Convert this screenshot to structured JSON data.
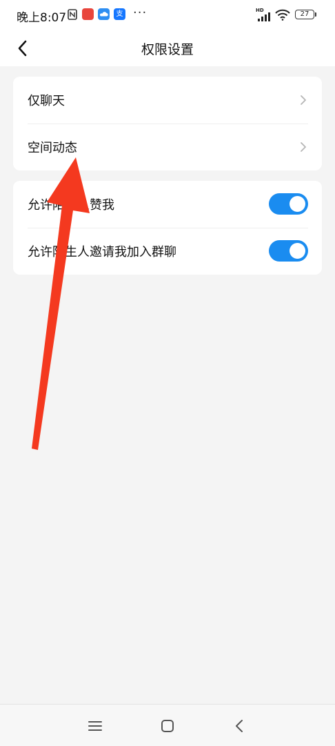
{
  "status_bar": {
    "time": "晚上8:07",
    "hd_label": "HD",
    "battery_level": "27",
    "app_icons": [
      {
        "name": "nfc-icon",
        "color": "#333333"
      },
      {
        "name": "red-app-icon",
        "color": "#e8453c"
      },
      {
        "name": "cloud-app-icon",
        "color": "#2e8ef2"
      },
      {
        "name": "alipay-icon",
        "color": "#1677ff",
        "glyph": "支"
      }
    ],
    "more": "···"
  },
  "header": {
    "title": "权限设置"
  },
  "sections": [
    {
      "items": [
        {
          "label": "仅聊天",
          "control": "chevron"
        },
        {
          "label": "空间动态",
          "control": "chevron"
        }
      ]
    },
    {
      "items": [
        {
          "label": "允许陌生人赞我",
          "control": "toggle",
          "on": true
        },
        {
          "label": "允许陌生人邀请我加入群聊",
          "control": "toggle",
          "on": true
        }
      ]
    }
  ],
  "colors": {
    "toggle_on": "#1a8cf0",
    "annotation_arrow": "#f4391f",
    "page_background": "#f4f4f4"
  },
  "annotation": {
    "type": "arrow",
    "target": "空间动态"
  },
  "system_nav": [
    "menu-icon",
    "home-icon",
    "back-icon"
  ]
}
